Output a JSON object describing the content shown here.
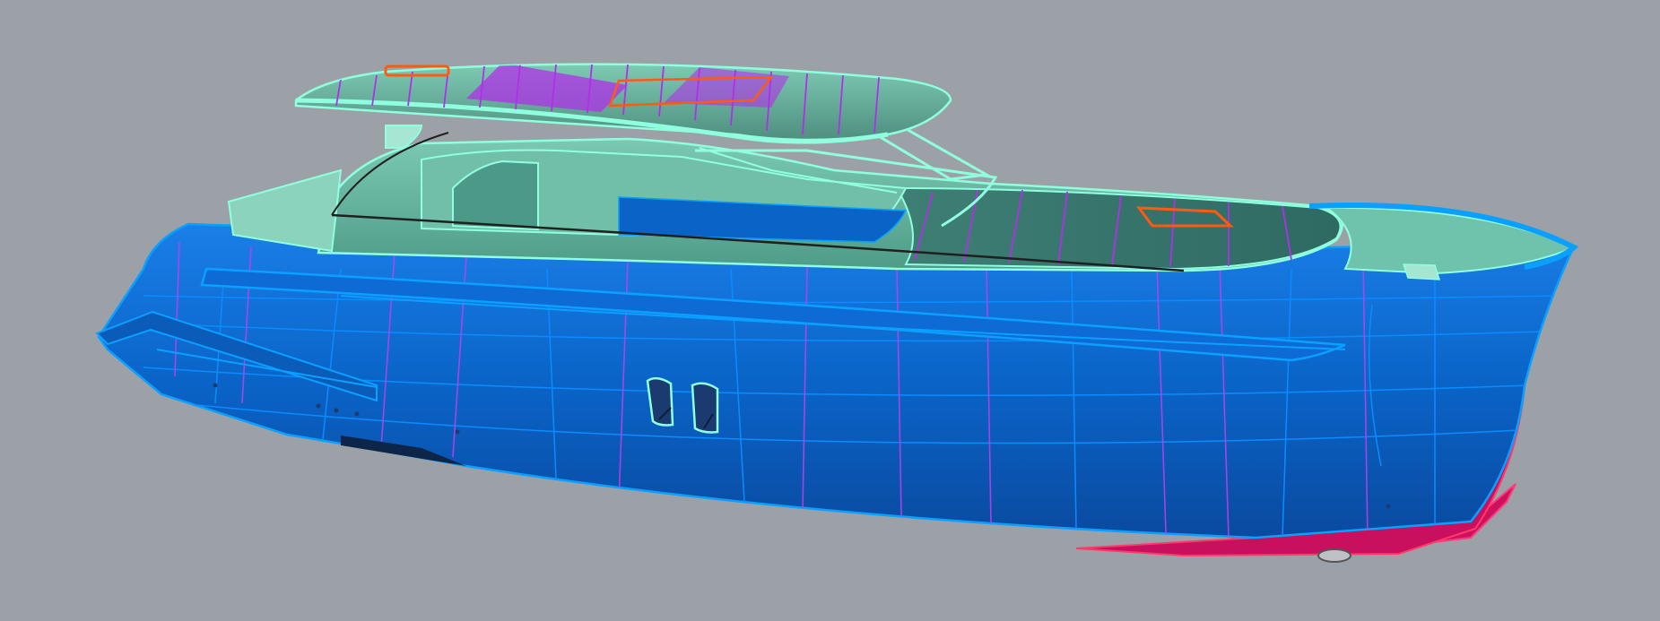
{
  "viewport": {
    "background": "#9ca1a7",
    "render_style": "shaded-with-edges"
  },
  "model": {
    "subject": "motor-yacht-3d-model",
    "colors": {
      "hull": "#0a64c8",
      "hull_edge": "#0aa0ff",
      "superstructure": "#62b6a0",
      "superstructure_edge": "#8fffe0",
      "stripe": "#b030e8",
      "antifouling": "#c8105e",
      "hatch": "#ff5a14"
    },
    "parts": [
      "hull",
      "superstructure",
      "hardtop",
      "bow-deck",
      "portholes",
      "stern-platform",
      "antifouling"
    ]
  }
}
